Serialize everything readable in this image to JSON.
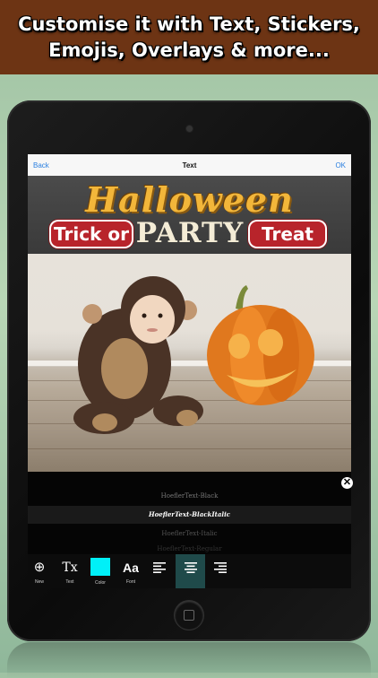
{
  "banner": {
    "line1": "Customise it with Text, Stickers,",
    "line2": "Emojis, Overlays & more..."
  },
  "navbar": {
    "back_label": "Back",
    "title": "Text",
    "ok_label": "OK"
  },
  "overlay": {
    "title": "Halloween",
    "left_pill": "Trick or",
    "center": "PARTY",
    "right_pill": "Treat"
  },
  "font_picker": {
    "items": [
      {
        "label": "HoeflerText-Black",
        "selected": false
      },
      {
        "label": "HoeflerText-BlackItalic",
        "selected": true
      },
      {
        "label": "HoeflerText-Italic",
        "selected": false
      },
      {
        "label": "HoeflerText-Regular",
        "selected": false
      }
    ]
  },
  "toolbar": {
    "items": [
      {
        "icon": "add-icon",
        "glyph": "⊕",
        "label": "New"
      },
      {
        "icon": "text-icon",
        "glyph": "Tx",
        "label": "Text"
      },
      {
        "icon": "color-swatch",
        "glyph": "",
        "label": "Color",
        "color": "#00f0f8"
      },
      {
        "icon": "font-icon",
        "glyph": "Aa",
        "label": "Font"
      },
      {
        "icon": "align-left-icon",
        "glyph": "≡",
        "label": ""
      },
      {
        "icon": "align-center-icon",
        "glyph": "≡",
        "label": "",
        "active": true
      },
      {
        "icon": "align-right-icon",
        "glyph": "≡",
        "label": ""
      }
    ]
  },
  "colors": {
    "accent": "#2a7fe0",
    "banner_bg": "#6d3414",
    "halloween_orange": "#f2b63a",
    "pill_red": "#b8242b"
  }
}
